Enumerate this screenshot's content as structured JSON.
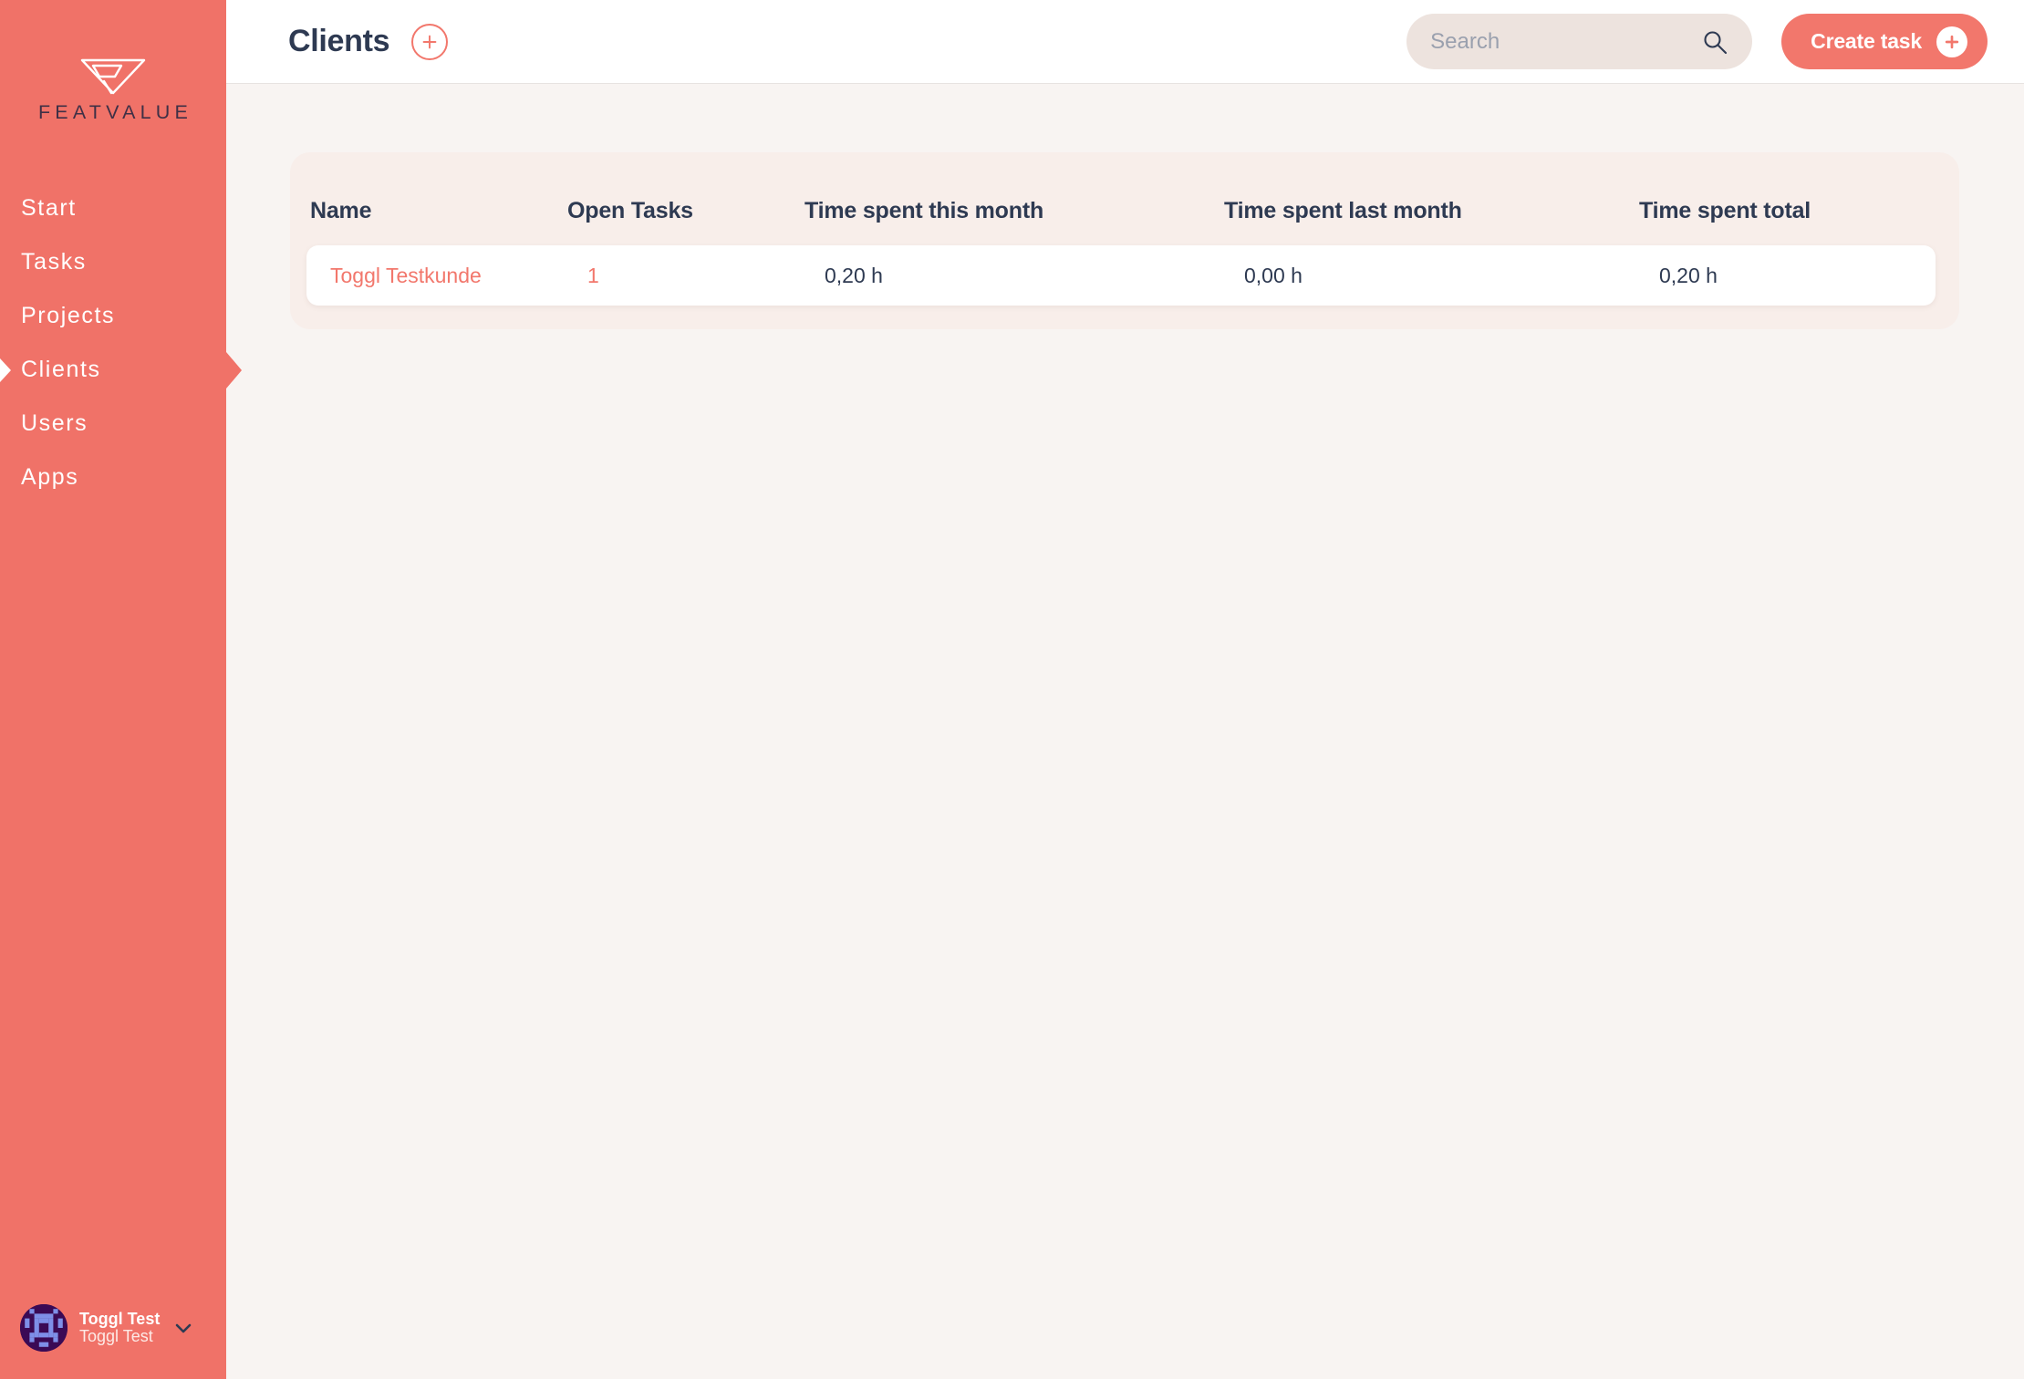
{
  "brand": {
    "logo_text": "FEATVALUE",
    "logo_icon": "funnel-triangle-logo-mark",
    "accent_color": "#F2776C",
    "sidebar_color": "#F07268",
    "text_color": "#2E3A52",
    "page_background": "#F8F4F2",
    "card_background": "#F8EEEA"
  },
  "sidebar": {
    "items": [
      {
        "label": "Start",
        "active": false
      },
      {
        "label": "Tasks",
        "active": false
      },
      {
        "label": "Projects",
        "active": false
      },
      {
        "label": "Clients",
        "active": true
      },
      {
        "label": "Users",
        "active": false
      },
      {
        "label": "Apps",
        "active": false
      }
    ],
    "profile": {
      "name": "Toggl Test",
      "subtitle": "Toggl Test",
      "avatar_icon": "identicon-avatar",
      "chevron_icon": "chevron-down-icon"
    }
  },
  "topbar": {
    "title": "Clients",
    "add_icon": "plus-circle-icon",
    "search": {
      "placeholder": "Search",
      "value": "",
      "icon": "search-icon"
    },
    "create_task": {
      "label": "Create task",
      "icon": "plus-icon"
    }
  },
  "table": {
    "columns": [
      "Name",
      "Open Tasks",
      "Time spent this month",
      "Time spent last month",
      "Time spent total"
    ],
    "rows": [
      {
        "name": "Toggl Testkunde",
        "open_tasks": "1",
        "time_this_month": "0,20 h",
        "time_last_month": "0,00 h",
        "time_total": "0,20 h"
      }
    ]
  }
}
